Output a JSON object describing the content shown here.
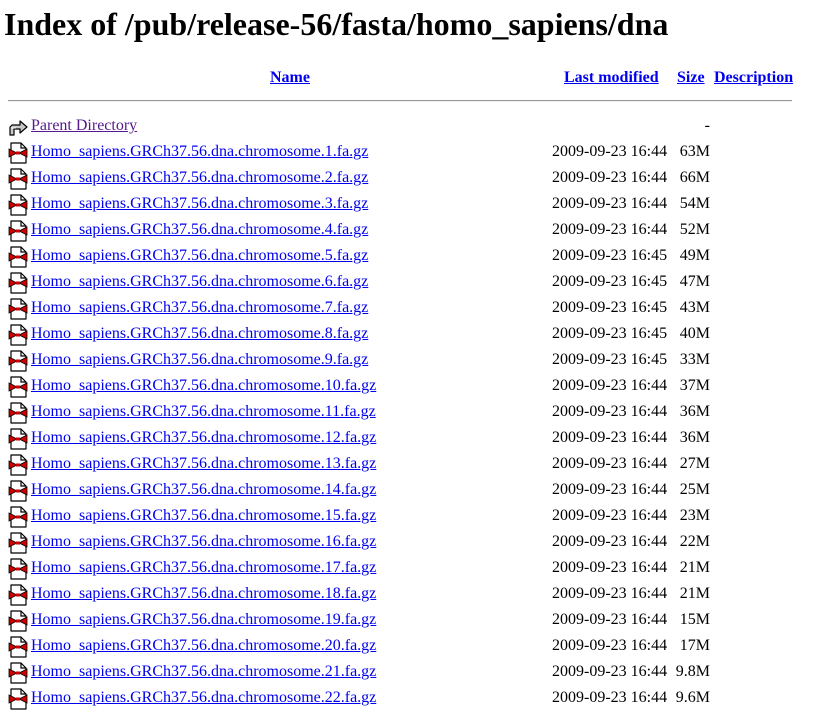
{
  "page_title": "Index of /pub/release-56/fasta/homo_sapiens/dna",
  "columns": {
    "name": "Name",
    "last_modified": "Last modified",
    "size": "Size",
    "description": "Description"
  },
  "parent": {
    "label": "Parent Directory",
    "size": "-",
    "icon": "back-arrow-icon"
  },
  "files": [
    {
      "name": "Homo_sapiens.GRCh37.56.dna.chromosome.1.fa.gz",
      "date": "2009-09-23 16:44",
      "size": "63M"
    },
    {
      "name": "Homo_sapiens.GRCh37.56.dna.chromosome.2.fa.gz",
      "date": "2009-09-23 16:44",
      "size": "66M"
    },
    {
      "name": "Homo_sapiens.GRCh37.56.dna.chromosome.3.fa.gz",
      "date": "2009-09-23 16:44",
      "size": "54M"
    },
    {
      "name": "Homo_sapiens.GRCh37.56.dna.chromosome.4.fa.gz",
      "date": "2009-09-23 16:44",
      "size": "52M"
    },
    {
      "name": "Homo_sapiens.GRCh37.56.dna.chromosome.5.fa.gz",
      "date": "2009-09-23 16:45",
      "size": "49M"
    },
    {
      "name": "Homo_sapiens.GRCh37.56.dna.chromosome.6.fa.gz",
      "date": "2009-09-23 16:45",
      "size": "47M"
    },
    {
      "name": "Homo_sapiens.GRCh37.56.dna.chromosome.7.fa.gz",
      "date": "2009-09-23 16:45",
      "size": "43M"
    },
    {
      "name": "Homo_sapiens.GRCh37.56.dna.chromosome.8.fa.gz",
      "date": "2009-09-23 16:45",
      "size": "40M"
    },
    {
      "name": "Homo_sapiens.GRCh37.56.dna.chromosome.9.fa.gz",
      "date": "2009-09-23 16:45",
      "size": "33M"
    },
    {
      "name": "Homo_sapiens.GRCh37.56.dna.chromosome.10.fa.gz",
      "date": "2009-09-23 16:44",
      "size": "37M"
    },
    {
      "name": "Homo_sapiens.GRCh37.56.dna.chromosome.11.fa.gz",
      "date": "2009-09-23 16:44",
      "size": "36M"
    },
    {
      "name": "Homo_sapiens.GRCh37.56.dna.chromosome.12.fa.gz",
      "date": "2009-09-23 16:44",
      "size": "36M"
    },
    {
      "name": "Homo_sapiens.GRCh37.56.dna.chromosome.13.fa.gz",
      "date": "2009-09-23 16:44",
      "size": "27M"
    },
    {
      "name": "Homo_sapiens.GRCh37.56.dna.chromosome.14.fa.gz",
      "date": "2009-09-23 16:44",
      "size": "25M"
    },
    {
      "name": "Homo_sapiens.GRCh37.56.dna.chromosome.15.fa.gz",
      "date": "2009-09-23 16:44",
      "size": "23M"
    },
    {
      "name": "Homo_sapiens.GRCh37.56.dna.chromosome.16.fa.gz",
      "date": "2009-09-23 16:44",
      "size": "22M"
    },
    {
      "name": "Homo_sapiens.GRCh37.56.dna.chromosome.17.fa.gz",
      "date": "2009-09-23 16:44",
      "size": "21M"
    },
    {
      "name": "Homo_sapiens.GRCh37.56.dna.chromosome.18.fa.gz",
      "date": "2009-09-23 16:44",
      "size": "21M"
    },
    {
      "name": "Homo_sapiens.GRCh37.56.dna.chromosome.19.fa.gz",
      "date": "2009-09-23 16:44",
      "size": "15M"
    },
    {
      "name": "Homo_sapiens.GRCh37.56.dna.chromosome.20.fa.gz",
      "date": "2009-09-23 16:44",
      "size": "17M"
    },
    {
      "name": "Homo_sapiens.GRCh37.56.dna.chromosome.21.fa.gz",
      "date": "2009-09-23 16:44",
      "size": "9.8M"
    },
    {
      "name": "Homo_sapiens.GRCh37.56.dna.chromosome.22.fa.gz",
      "date": "2009-09-23 16:44",
      "size": "9.6M"
    }
  ],
  "file_icon": "compressed-file-icon",
  "colors": {
    "link": "#0000ee",
    "visited_link": "#551a8b",
    "icon_red": "#cc0000"
  }
}
